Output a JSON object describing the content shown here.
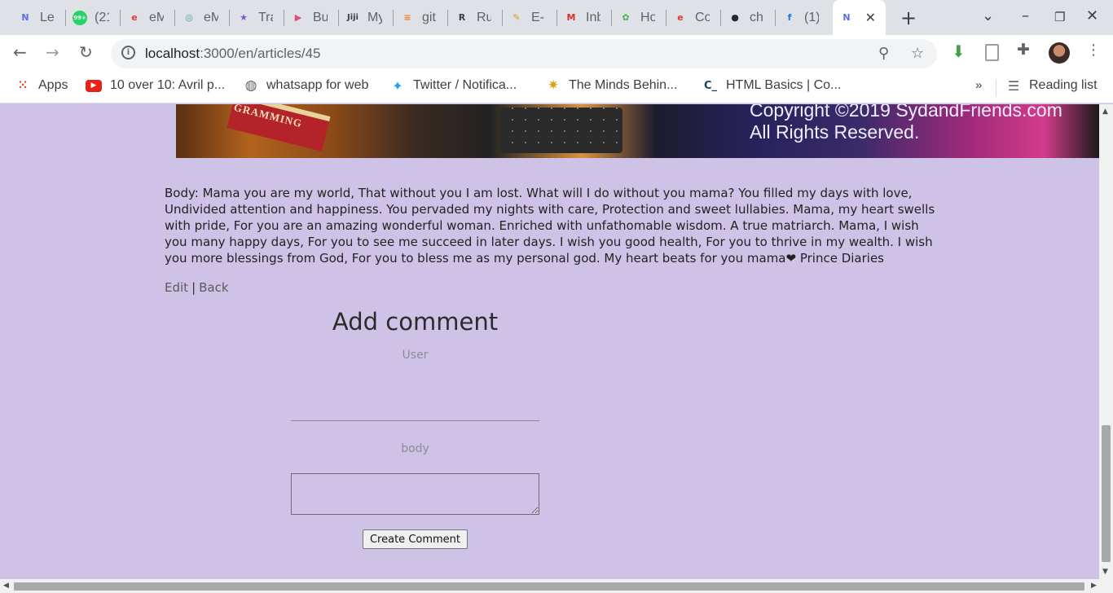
{
  "browser": {
    "tabs": [
      {
        "title": "Le",
        "icon": "microverse-icon",
        "glyph": "N",
        "color": "#5b6ee1"
      },
      {
        "title": "(21",
        "icon": "whatsapp-icon",
        "glyph": "99+",
        "color": "#25d366"
      },
      {
        "title": "eM",
        "icon": "emicroverse-icon",
        "glyph": "e",
        "color": "#e53935"
      },
      {
        "title": "eM",
        "icon": "chatgpt-like-icon",
        "glyph": "◎",
        "color": "#3aa39b"
      },
      {
        "title": "Tra",
        "icon": "star-icon",
        "glyph": "★",
        "color": "#7e57c2"
      },
      {
        "title": "Bu",
        "icon": "play-circle-icon",
        "glyph": "▶",
        "color": "#e8467c"
      },
      {
        "title": "My",
        "icon": "jiji-icon",
        "glyph": "Jiji",
        "color": "#3c4043"
      },
      {
        "title": "git",
        "icon": "stackoverflow-icon",
        "glyph": "≡",
        "color": "#f48024"
      },
      {
        "title": "Ru",
        "icon": "rails-icon",
        "glyph": "R",
        "color": "#3c4043"
      },
      {
        "title": "E-",
        "icon": "broom-icon",
        "glyph": "✎",
        "color": "#d4a017"
      },
      {
        "title": "Inb",
        "icon": "gmail-icon",
        "glyph": "M",
        "color": "#d93025"
      },
      {
        "title": "Ho",
        "icon": "plant-icon",
        "glyph": "✿",
        "color": "#4caf50"
      },
      {
        "title": "Co",
        "icon": "emicroverse-icon",
        "glyph": "e",
        "color": "#e53935"
      },
      {
        "title": "ch",
        "icon": "github-icon",
        "glyph": "●",
        "color": "#24292e"
      },
      {
        "title": "(1)",
        "icon": "facebook-icon",
        "glyph": "f",
        "color": "#1877f2"
      },
      {
        "title": "",
        "icon": "microverse-icon",
        "glyph": "N",
        "color": "#5b6ee1",
        "active": true
      }
    ],
    "url_host": "localhost",
    "url_rest": ":3000/en/articles/45",
    "bookmarks": [
      {
        "label": "Apps",
        "icon": "apps-grid-icon"
      },
      {
        "label": "10 over 10: Avril p...",
        "icon": "youtube-icon"
      },
      {
        "label": "whatsapp for web",
        "icon": "globe-icon"
      },
      {
        "label": "Twitter / Notifica...",
        "icon": "twitter-icon"
      },
      {
        "label": "The Minds Behin...",
        "icon": "sun-icon"
      },
      {
        "label": "HTML Basics | Co...",
        "icon": "codecademy-icon"
      }
    ],
    "bookmarks_overflow": "»",
    "reading_list": "Reading list"
  },
  "banner": {
    "book_text": "GRAMMING",
    "copyright_line1": "Copyright ©2019 SydandFriends.com",
    "copyright_line2": "All Rights Reserved."
  },
  "article": {
    "body": "Body: Mama you are my world, That without you I am lost. What will I do without you mama? You filled my days with love, Undivided attention and happiness. You pervaded my nights with care, Protection and sweet lullabies. Mama, my heart swells with pride, For you are an amazing wonderful woman. Enriched with unfathomable wisdom. A true matriarch. Mama, I wish you many happy days, For you to see me succeed in later days. I wish you good health, For you to thrive in my wealth. I wish you more blessings from God, For you to bless me as my personal god. My heart beats for you mama❤ Prince Diaries",
    "edit_label": "Edit",
    "separator": "|",
    "back_label": "Back"
  },
  "comment_form": {
    "heading": "Add comment",
    "user_label": "User",
    "user_value": "",
    "body_label": "body",
    "body_value": "",
    "submit_label": "Create Comment"
  }
}
